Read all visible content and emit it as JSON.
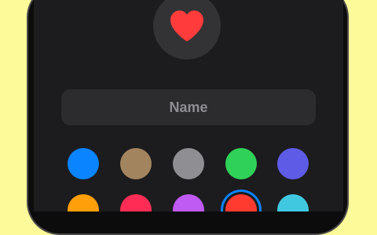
{
  "background_color": "#FDFA99",
  "selected_icon": {
    "name": "heart-icon",
    "color": "#FF3B3B"
  },
  "name_field": {
    "placeholder": "Name",
    "value": ""
  },
  "colors": {
    "selected": "red",
    "rows": [
      [
        {
          "name": "blue",
          "hex": "#0A84FF"
        },
        {
          "name": "brown",
          "hex": "#A2845E"
        },
        {
          "name": "gray",
          "hex": "#8E8E93"
        },
        {
          "name": "green",
          "hex": "#30D158"
        },
        {
          "name": "indigo",
          "hex": "#5E5CE6"
        }
      ],
      [
        {
          "name": "orange",
          "hex": "#FF9F0A"
        },
        {
          "name": "pink",
          "hex": "#FF2D55"
        },
        {
          "name": "purple",
          "hex": "#BF5AF2"
        },
        {
          "name": "red",
          "hex": "#FF3B30"
        },
        {
          "name": "teal",
          "hex": "#40C8E0"
        }
      ]
    ]
  }
}
